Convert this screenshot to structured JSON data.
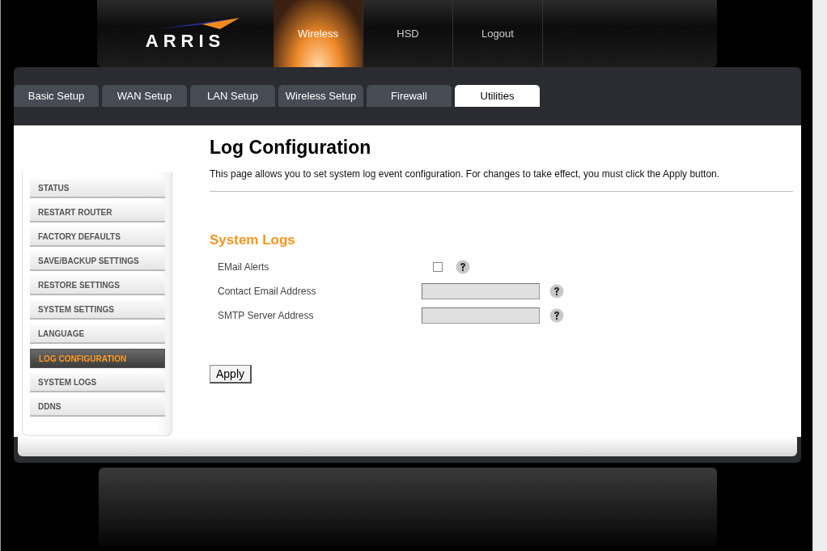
{
  "logo": "ARRIS",
  "top_nav": [
    {
      "label": "Wireless",
      "selected": true
    },
    {
      "label": "HSD",
      "selected": false
    },
    {
      "label": "Logout",
      "selected": false
    }
  ],
  "tabs": [
    {
      "label": "Basic Setup",
      "selected": false
    },
    {
      "label": "WAN Setup",
      "selected": false
    },
    {
      "label": "LAN Setup",
      "selected": false
    },
    {
      "label": "Wireless Setup",
      "selected": false
    },
    {
      "label": "Firewall",
      "selected": false
    },
    {
      "label": "Utilities",
      "selected": true
    }
  ],
  "sidebar": {
    "items": [
      {
        "label": "STATUS",
        "selected": false
      },
      {
        "label": "RESTART ROUTER",
        "selected": false
      },
      {
        "label": "FACTORY DEFAULTS",
        "selected": false
      },
      {
        "label": "SAVE/BACKUP SETTINGS",
        "selected": false
      },
      {
        "label": "RESTORE SETTINGS",
        "selected": false
      },
      {
        "label": "SYSTEM SETTINGS",
        "selected": false
      },
      {
        "label": "LANGUAGE",
        "selected": false
      },
      {
        "label": "LOG CONFIGURATION",
        "selected": true
      },
      {
        "label": "SYSTEM LOGS",
        "selected": false
      },
      {
        "label": "DDNS",
        "selected": false
      }
    ]
  },
  "page": {
    "title": "Log Configuration",
    "description": "This page allows you to set system log event configuration. For changes to take effect, you must click the Apply button.",
    "section": "System Logs",
    "fields": [
      {
        "kind": "checkbox",
        "label": "EMail Alerts",
        "checked": false
      },
      {
        "kind": "text",
        "label": "Contact Email Address"
      },
      {
        "kind": "text",
        "label": "SMTP Server Address"
      }
    ],
    "apply_button": "Apply"
  }
}
